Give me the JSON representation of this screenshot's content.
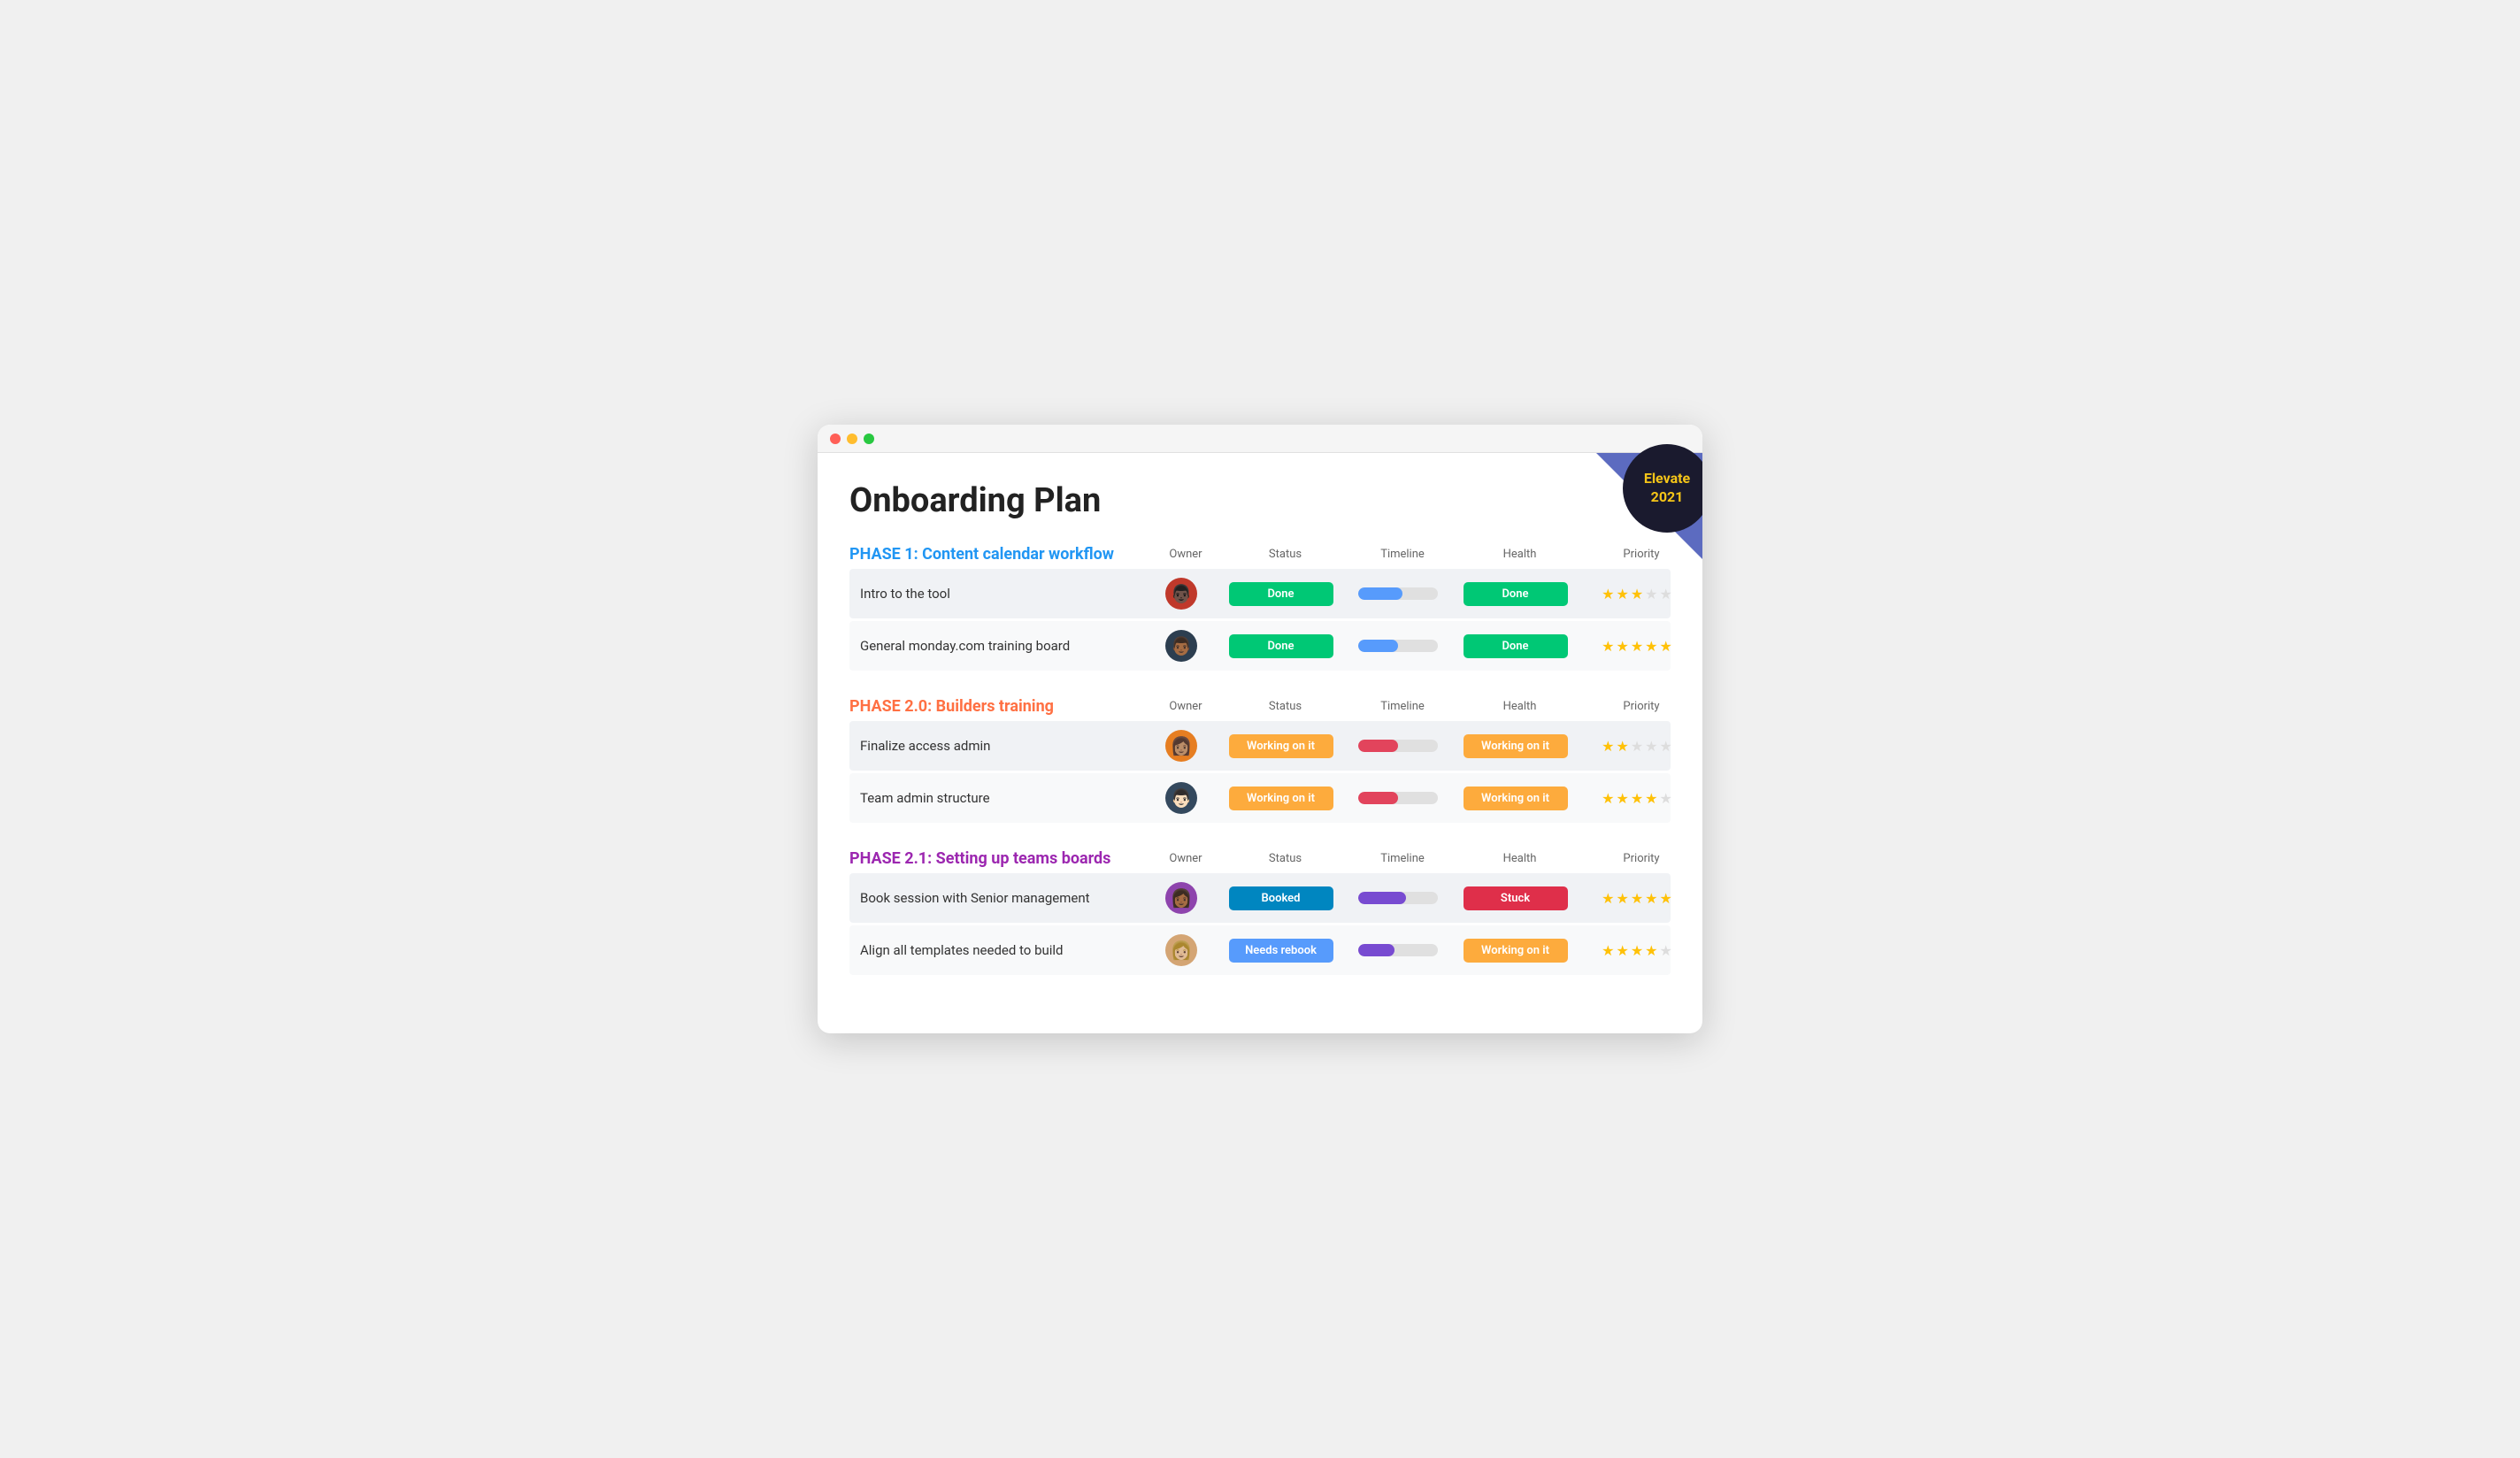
{
  "page": {
    "title": "Onboarding Plan"
  },
  "badge": {
    "line1": "Elevate",
    "line2": "2021"
  },
  "phases": [
    {
      "id": "phase1",
      "title": "PHASE 1: Content calendar workflow",
      "color": "blue",
      "columns": [
        "Owner",
        "Status",
        "Timeline",
        "Health",
        "Priority"
      ],
      "tasks": [
        {
          "name": "Intro to the tool",
          "owner_emoji": "👨🏿",
          "owner_color": "#c0392b",
          "status_label": "Done",
          "status_class": "status-done",
          "timeline_pct": 55,
          "timeline_color": "#579bfc",
          "health_label": "Done",
          "health_class": "status-done",
          "stars": 3
        },
        {
          "name": "General monday.com training board",
          "owner_emoji": "👨🏾",
          "owner_color": "#2c3e50",
          "status_label": "Done",
          "status_class": "status-done",
          "timeline_pct": 50,
          "timeline_color": "#579bfc",
          "health_label": "Done",
          "health_class": "status-done",
          "stars": 5
        }
      ]
    },
    {
      "id": "phase2",
      "title": "PHASE 2.0: Builders training",
      "color": "orange",
      "columns": [
        "Owner",
        "Status",
        "Timeline",
        "Health",
        "Priority"
      ],
      "tasks": [
        {
          "name": "Finalize access admin",
          "owner_emoji": "👩🏽",
          "owner_color": "#e67e22",
          "status_label": "Working on it",
          "status_class": "status-working",
          "timeline_pct": 50,
          "timeline_color": "#e2445c",
          "health_label": "Working on it",
          "health_class": "status-working",
          "stars": 2
        },
        {
          "name": "Team admin structure",
          "owner_emoji": "👨🏻",
          "owner_color": "#34495e",
          "status_label": "Working on it",
          "status_class": "status-working",
          "timeline_pct": 50,
          "timeline_color": "#e2445c",
          "health_label": "Working on it",
          "health_class": "status-working",
          "stars": 4
        }
      ]
    },
    {
      "id": "phase21",
      "title": "PHASE 2.1: Setting up teams boards",
      "color": "purple",
      "columns": [
        "Owner",
        "Status",
        "Timeline",
        "Health",
        "Priority"
      ],
      "tasks": [
        {
          "name": "Book session with Senior management",
          "owner_emoji": "👩🏾",
          "owner_color": "#8e44ad",
          "status_label": "Booked",
          "status_class": "status-booked",
          "timeline_pct": 60,
          "timeline_color": "#784bd1",
          "health_label": "Stuck",
          "health_class": "status-stuck",
          "stars": 5
        },
        {
          "name": "Align all templates needed to build",
          "owner_emoji": "👩🏼",
          "owner_color": "#d4a574",
          "status_label": "Needs rebook",
          "status_class": "status-needs-rebook",
          "timeline_pct": 45,
          "timeline_color": "#784bd1",
          "health_label": "Working on it",
          "health_class": "status-working",
          "stars": 4
        }
      ]
    }
  ]
}
